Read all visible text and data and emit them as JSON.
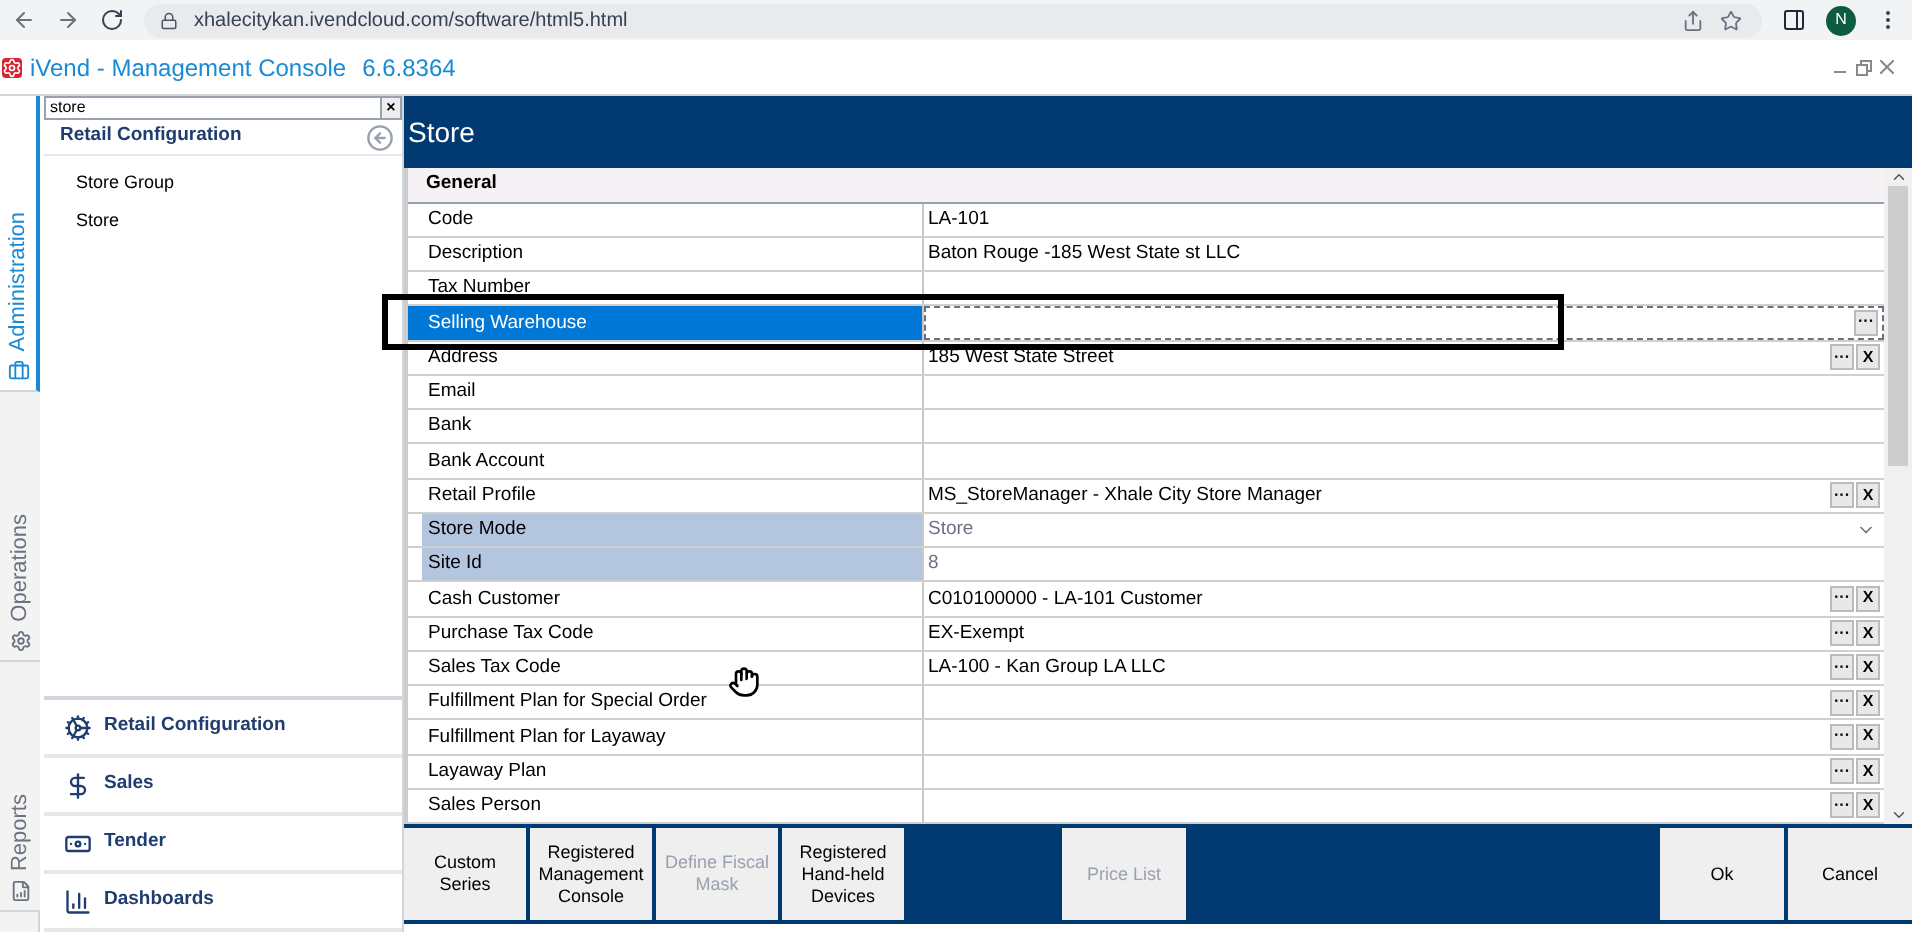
{
  "browser": {
    "url": "xhalecitykan.ivendcloud.com/software/html5.html",
    "avatar": "N"
  },
  "app": {
    "title": "iVend - Management Console",
    "version": "6.6.8364"
  },
  "side_tabs": [
    {
      "label": "Administration",
      "selected": true
    },
    {
      "label": "Operations",
      "selected": false
    },
    {
      "label": "Reports",
      "selected": false
    }
  ],
  "sidebar": {
    "search": "store",
    "clear": "×",
    "heading": "Retail Configuration",
    "items": [
      {
        "label": "Store Group"
      },
      {
        "label": "Store"
      }
    ],
    "nav": [
      {
        "label": "Retail Configuration",
        "kind": "gears"
      },
      {
        "label": "Sales",
        "kind": "sales"
      },
      {
        "label": "Tender",
        "kind": "tender"
      },
      {
        "label": "Dashboards",
        "kind": "chart"
      }
    ]
  },
  "page": {
    "title": "Store",
    "section": "General",
    "rows": [
      {
        "label": "Code",
        "value": "LA-101",
        "selected": false,
        "readonly": false,
        "kind": "text",
        "actions": []
      },
      {
        "label": "Description",
        "value": "Baton Rouge -185 West State st LLC",
        "selected": false,
        "readonly": false,
        "kind": "text",
        "actions": []
      },
      {
        "label": "Tax Number",
        "value": "",
        "selected": false,
        "readonly": false,
        "kind": "text",
        "actions": []
      },
      {
        "label": "Selling Warehouse",
        "value": "",
        "selected": true,
        "readonly": false,
        "kind": "text",
        "actions": [
          "···"
        ]
      },
      {
        "label": "Address",
        "value": "185 West State Street",
        "selected": false,
        "readonly": false,
        "kind": "text",
        "actions": [
          "···",
          "X"
        ]
      },
      {
        "label": "Email",
        "value": "",
        "selected": false,
        "readonly": false,
        "kind": "text",
        "actions": []
      },
      {
        "label": "Bank",
        "value": "",
        "selected": false,
        "readonly": false,
        "kind": "text",
        "actions": []
      },
      {
        "label": "Bank Account",
        "value": "",
        "selected": false,
        "readonly": false,
        "kind": "text",
        "actions": []
      },
      {
        "label": "Retail Profile",
        "value": "MS_StoreManager - Xhale City Store Manager",
        "selected": false,
        "readonly": false,
        "kind": "text",
        "actions": [
          "···",
          "X"
        ]
      },
      {
        "label": "Store Mode",
        "value": "Store",
        "selected": false,
        "readonly": true,
        "kind": "dropdown",
        "actions": []
      },
      {
        "label": "Site Id",
        "value": "8",
        "selected": false,
        "readonly": true,
        "kind": "text",
        "actions": []
      },
      {
        "label": "Cash Customer",
        "value": "C010100000 - LA-101 Customer",
        "selected": false,
        "readonly": false,
        "kind": "text",
        "actions": [
          "···",
          "X"
        ]
      },
      {
        "label": "Purchase Tax Code",
        "value": "EX-Exempt",
        "selected": false,
        "readonly": false,
        "kind": "text",
        "actions": [
          "···",
          "X"
        ]
      },
      {
        "label": "Sales Tax Code",
        "value": "LA-100 - Kan Group LA LLC",
        "selected": false,
        "readonly": false,
        "kind": "text",
        "actions": [
          "···",
          "X"
        ]
      },
      {
        "label": "Fulfillment Plan for Special Order",
        "value": "",
        "selected": false,
        "readonly": false,
        "kind": "text",
        "actions": [
          "···",
          "X"
        ]
      },
      {
        "label": "Fulfillment Plan for Layaway",
        "value": "",
        "selected": false,
        "readonly": false,
        "kind": "text",
        "actions": [
          "···",
          "X"
        ]
      },
      {
        "label": "Layaway Plan",
        "value": "",
        "selected": false,
        "readonly": false,
        "kind": "text",
        "actions": [
          "···",
          "X"
        ]
      },
      {
        "label": "Sales Person",
        "value": "",
        "selected": false,
        "readonly": false,
        "kind": "text",
        "actions": [
          "···",
          "X"
        ]
      }
    ],
    "footer_left": [
      {
        "label": "Custom Series",
        "disabled": false
      },
      {
        "label": "Registered Management Console",
        "disabled": false
      },
      {
        "label": "Define Fiscal Mask",
        "disabled": true
      },
      {
        "label": "Registered Hand-held Devices",
        "disabled": false
      }
    ],
    "footer_mid": [
      {
        "label": "Price List",
        "disabled": true
      }
    ],
    "footer_right": [
      {
        "label": "Ok",
        "disabled": false
      },
      {
        "label": "Cancel",
        "disabled": false
      }
    ]
  }
}
